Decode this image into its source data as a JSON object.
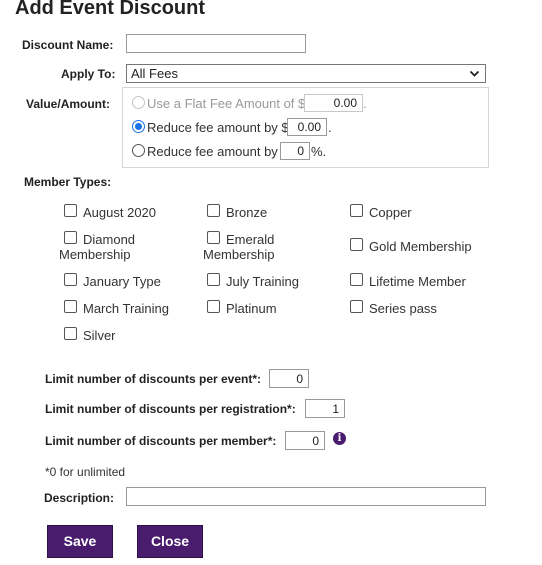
{
  "dialog": {
    "title": "Add Event Discount"
  },
  "form": {
    "discount_name": {
      "label": "Discount Name:",
      "value": ""
    },
    "apply_to": {
      "label": "Apply To:",
      "selected": "All Fees"
    },
    "value_amount": {
      "label": "Value/Amount:",
      "options": [
        {
          "label": "Use a Flat Fee Amount of $",
          "value": "0.00",
          "suffix": ".",
          "selected": false,
          "disabled": true
        },
        {
          "label": "Reduce fee amount by $",
          "value": "0.00",
          "suffix": ".",
          "selected": true,
          "disabled": false
        },
        {
          "label": "Reduce fee amount by",
          "value": "0",
          "suffix": "%.",
          "selected": false,
          "disabled": false
        }
      ]
    },
    "member_types": {
      "label": "Member Types:",
      "items": [
        {
          "label": "August 2020",
          "checked": false
        },
        {
          "label": "Bronze",
          "checked": false
        },
        {
          "label": "Copper",
          "checked": false
        },
        {
          "label": "Diamond",
          "label2": "Membership",
          "checked": false
        },
        {
          "label": "Emerald",
          "label2": "Membership",
          "checked": false
        },
        {
          "label": "Gold Membership",
          "checked": false
        },
        {
          "label": "January Type",
          "checked": false
        },
        {
          "label": "July Training",
          "checked": false
        },
        {
          "label": "Lifetime Member",
          "checked": false
        },
        {
          "label": "March Training",
          "checked": false
        },
        {
          "label": "Platinum",
          "checked": false
        },
        {
          "label": "Series pass",
          "checked": false
        },
        {
          "label": "Silver",
          "checked": false
        }
      ]
    },
    "limits": {
      "per_event": {
        "label": "Limit number of discounts per event*:",
        "value": "0"
      },
      "per_registration": {
        "label": "Limit number of discounts per registration*:",
        "value": "1"
      },
      "per_member": {
        "label": "Limit number of discounts per member*:",
        "value": "0"
      },
      "note": "*0 for unlimited"
    },
    "description": {
      "label": "Description:",
      "value": ""
    }
  },
  "buttons": {
    "save": "Save",
    "close": "Close"
  },
  "icons": {
    "info": "info-icon",
    "select_arrow": "chevron-down-icon"
  },
  "colors": {
    "button_bg": "#4a1c6e",
    "radio_accent": "#1a73e8"
  }
}
